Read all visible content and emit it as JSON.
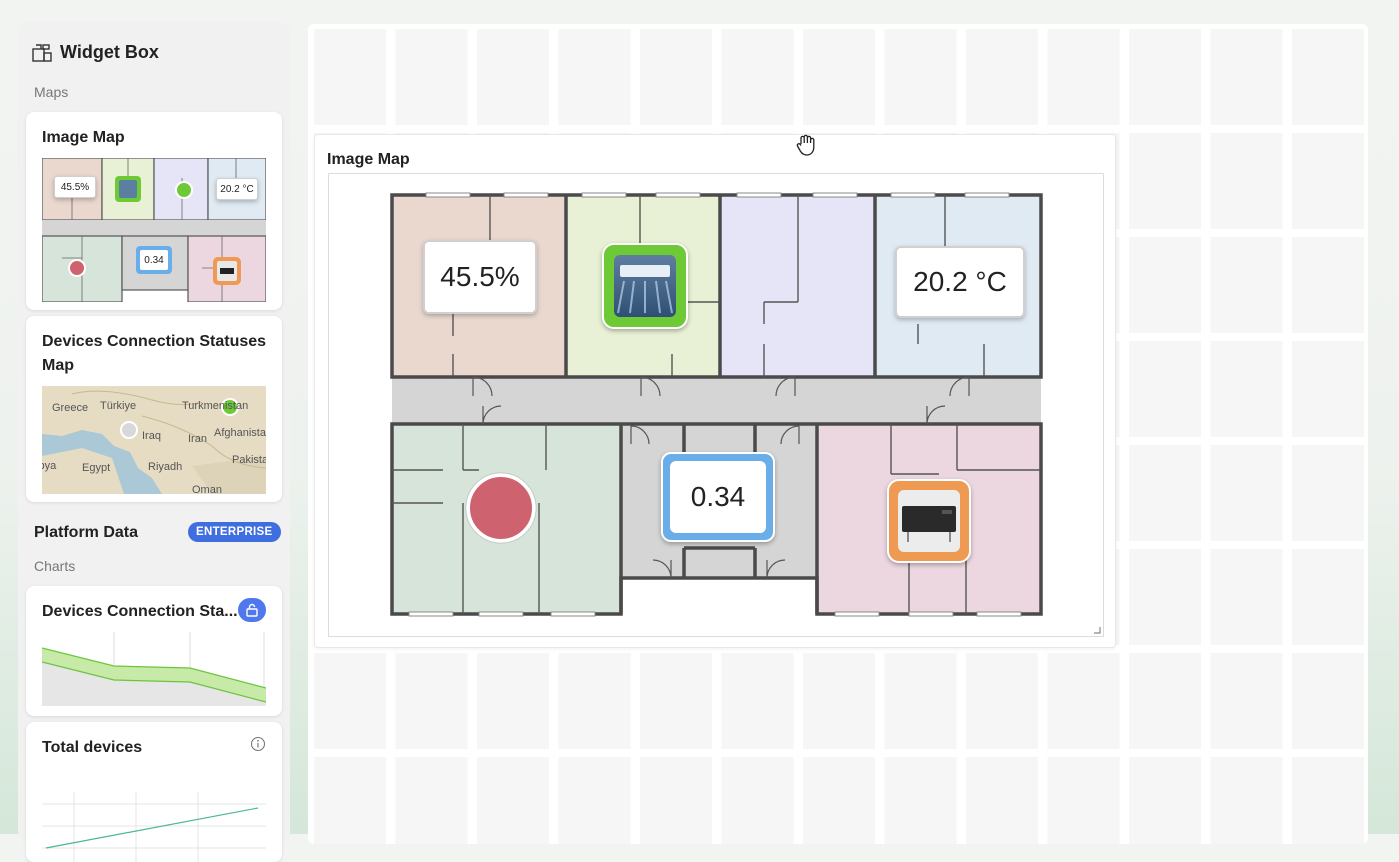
{
  "widget_box": {
    "title": "Widget Box",
    "maps_label": "Maps",
    "image_map_card": {
      "title": "Image Map",
      "preview": {
        "humidity": "45.5%",
        "temperature": "20.2 °C",
        "value": "0.34"
      }
    },
    "devices_map_card": {
      "title": "Devices Connection Statuses Map",
      "map_labels": [
        "Greece",
        "Türkiye",
        "Turkmenistan",
        "Iraq",
        "Iran",
        "Afghanistan",
        "Egypt",
        "Riyadh",
        "Pakistan",
        "Oman",
        "Libya"
      ]
    },
    "platform_data": {
      "label": "Platform Data",
      "badge": "ENTERPRISE"
    },
    "charts_label": "Charts",
    "devices_chart_card": {
      "title": "Devices Connection Sta..."
    },
    "total_devices_card": {
      "title": "Total devices"
    }
  },
  "dashboard": {
    "image_map_widget": {
      "title": "Image Map",
      "humidity": "45.5%",
      "temperature": "20.2 °C",
      "value": "0.34"
    }
  },
  "colors": {
    "accent_blue": "#3f6ee0",
    "online_green": "#6dc935",
    "alarm_red": "#cf626f",
    "value_blue": "#69aee8",
    "heater_orange": "#ef9a52",
    "room_pink": "#ead8cf",
    "room_lime": "#e8f1d5",
    "room_lavender": "#e5e5f7",
    "room_sky": "#dfeaf3",
    "room_green": "#d7e4da",
    "room_rose": "#ecd7e1",
    "corridor_gray": "#d5d5d5"
  },
  "icons": [
    "widget-box-icon",
    "lock-icon",
    "info-icon",
    "hand-cursor-icon",
    "air-conditioner-icon",
    "heater-icon",
    "resize-handle-icon"
  ]
}
